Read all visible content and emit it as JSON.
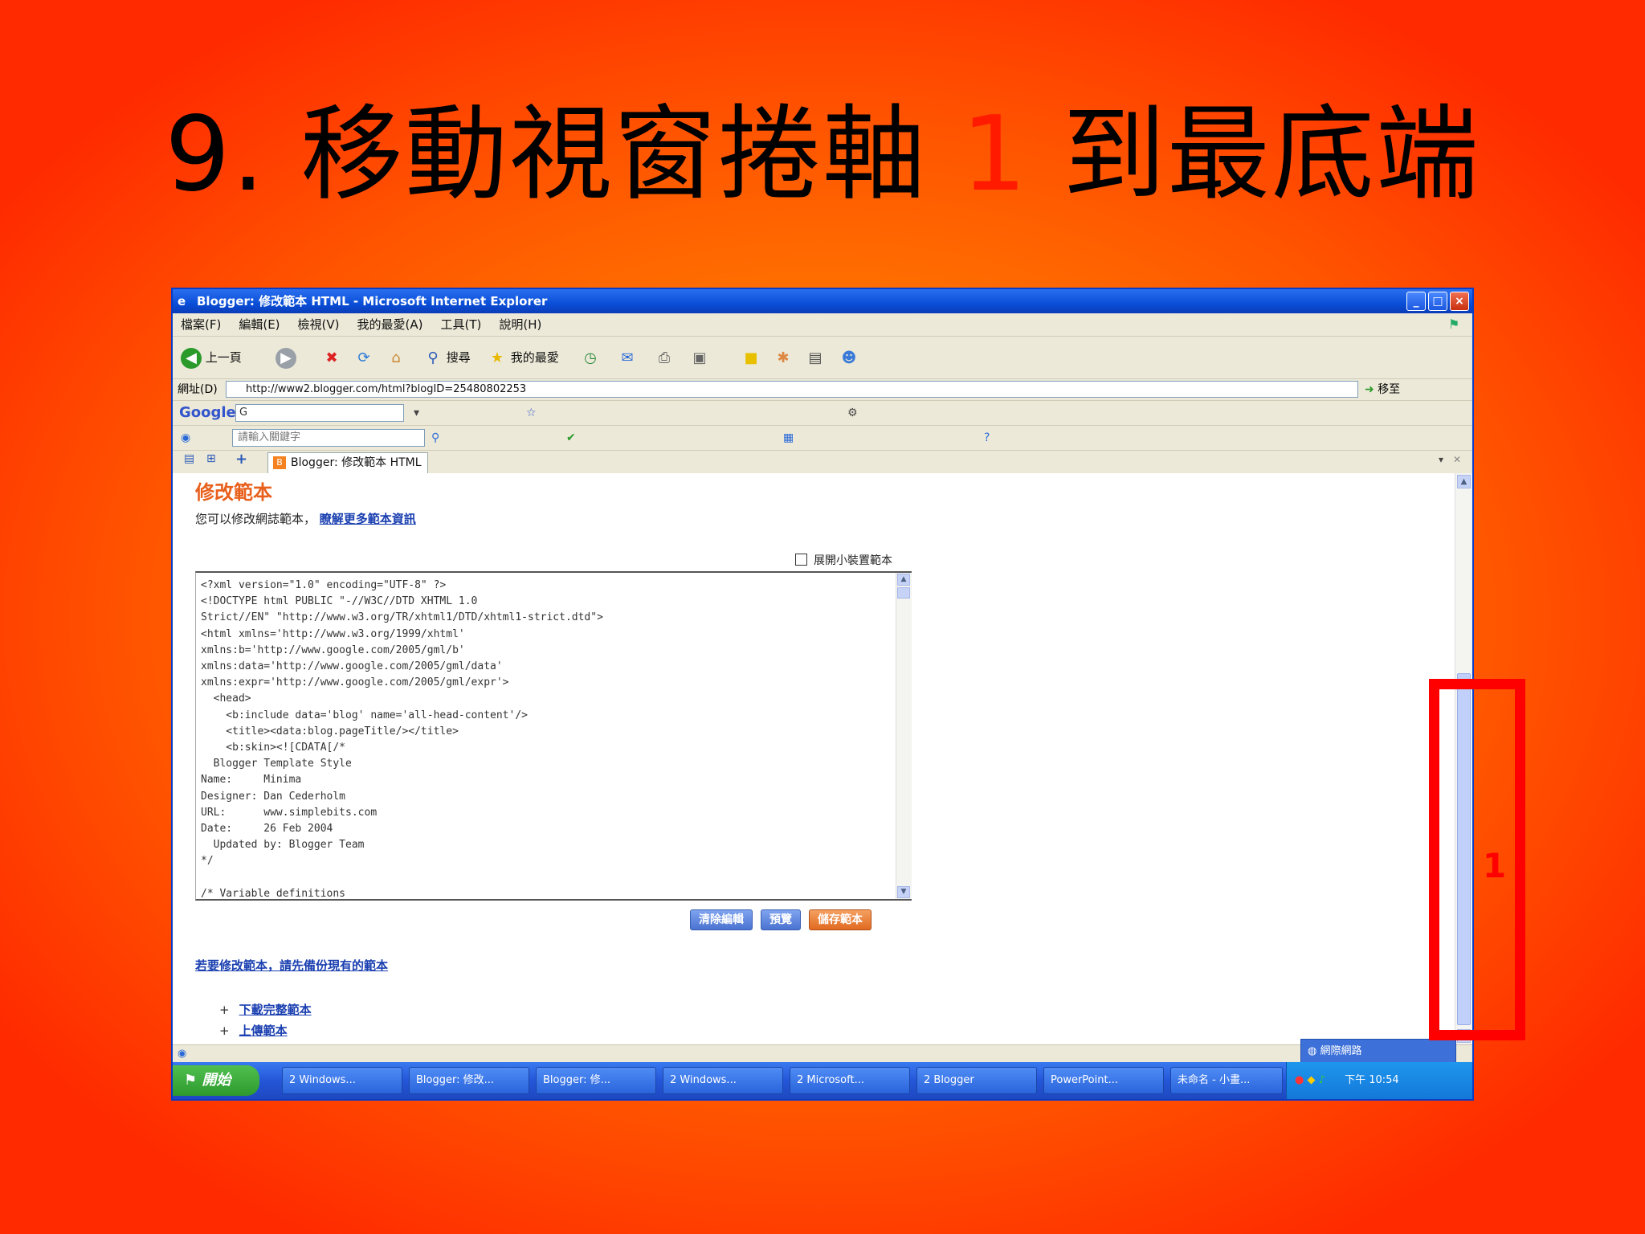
{
  "slide": {
    "title_prefix": "9. 移動視窗捲軸",
    "title_highlight": "1",
    "title_suffix": "到最底端",
    "annotation_number": "1",
    "highlight_color": "#ff0000"
  },
  "window": {
    "title": "Blogger: 修改範本 HTML - Microsoft Internet Explorer",
    "controls": {
      "minimize": "_",
      "maximize": "□",
      "close": "×"
    }
  },
  "menu": [
    "檔案(F)",
    "編輯(E)",
    "檢視(V)",
    "我的最愛(A)",
    "工具(T)",
    "說明(H)"
  ],
  "toolbar": {
    "back_label": "上一頁",
    "search_label": "搜尋",
    "favorites_label": "我的最愛"
  },
  "address": {
    "label": "網址(D)",
    "url": "http://www2.blogger.com/html?blogID=25480802253",
    "go_label": "移至"
  },
  "google_bar": {
    "logo": "Google",
    "search_value": "G"
  },
  "links_bar": {
    "search_placeholder": "請輸入關鍵字"
  },
  "tab": {
    "label": "Blogger: 修改範本 HTML",
    "icon": "B"
  },
  "content": {
    "heading": "修改範本",
    "subline_text": "您可以修改網誌範本，",
    "subline_link": "瞭解更多範本資訊",
    "wrap_label": "展開小裝置範本",
    "code_lines": [
      "<?xml version=\"1.0\" encoding=\"UTF-8\" ?>",
      "<!DOCTYPE html PUBLIC \"-//W3C//DTD XHTML 1.0",
      "Strict//EN\" \"http://www.w3.org/TR/xhtml1/DTD/xhtml1-strict.dtd\">",
      "<html xmlns='http://www.w3.org/1999/xhtml'",
      "xmlns:b='http://www.google.com/2005/gml/b'",
      "xmlns:data='http://www.google.com/2005/gml/data'",
      "xmlns:expr='http://www.google.com/2005/gml/expr'>",
      "  <head>",
      "    <b:include data='blog' name='all-head-content'/>",
      "    <title><data:blog.pageTitle/></title>",
      "    <b:skin><![CDATA[/*",
      "  Blogger Template Style",
      "Name:     Minima",
      "Designer: Dan Cederholm",
      "URL:      www.simplebits.com",
      "Date:     26 Feb 2004",
      "  Updated by: Blogger Team",
      "*/",
      "",
      "/* Variable definitions"
    ],
    "buttons": {
      "clear": "清除編輯",
      "preview": "預覽",
      "save": "儲存範本"
    },
    "bottom_link": "若要修改範本，請先備份現有的範本",
    "bullets": [
      "下載完整範本",
      "上傳範本"
    ]
  },
  "status": {
    "dropdown_label": "網際網路"
  },
  "taskbar": {
    "start_label": "開始",
    "tasks": [
      "2 Windows...",
      "Blogger: 修改...",
      "Blogger: 修...",
      "2 Windows...",
      "2 Microsoft...",
      "2 Blogger",
      "PowerPoint...",
      "未命名 - 小畫..."
    ],
    "clock": "下午 10:54"
  }
}
